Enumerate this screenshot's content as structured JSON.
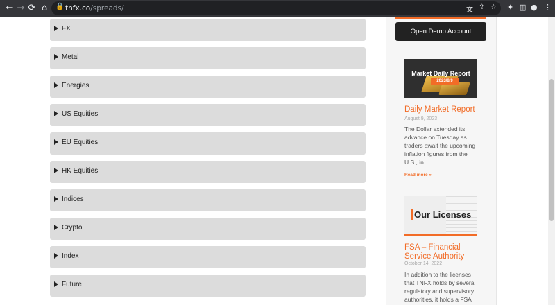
{
  "browser": {
    "url_domain": "tnfx.co",
    "url_path": "/spreads/"
  },
  "accordion": {
    "items": [
      {
        "label": "FX"
      },
      {
        "label": "Metal"
      },
      {
        "label": "Energies"
      },
      {
        "label": "US Equities"
      },
      {
        "label": "EU Equities"
      },
      {
        "label": "HK Equities"
      },
      {
        "label": "Indices"
      },
      {
        "label": "Crypto"
      },
      {
        "label": "Index"
      },
      {
        "label": "Future"
      }
    ]
  },
  "sidebar": {
    "demo_button": "Open Demo Account",
    "posts": [
      {
        "thumb_title": "Market Daily Report",
        "thumb_date": "2023/8/9",
        "title": "Daily Market Report",
        "date": "August 9, 2023",
        "excerpt": "The Dollar extended its advance on Tuesday as traders await the upcoming inflation figures from the U.S., in",
        "read_more": "Read more »"
      },
      {
        "thumb_title": "Our Licenses",
        "title": "FSA – Financial Service Authority",
        "date": "October 14, 2022",
        "excerpt": "In addition to the licenses that TNFX holds by several regulatory and supervisory authorities, it holds a FSA"
      }
    ]
  },
  "colors": {
    "accent": "#f26c27",
    "accordion_bg": "#dcdcdc",
    "button_dark": "#222222"
  }
}
